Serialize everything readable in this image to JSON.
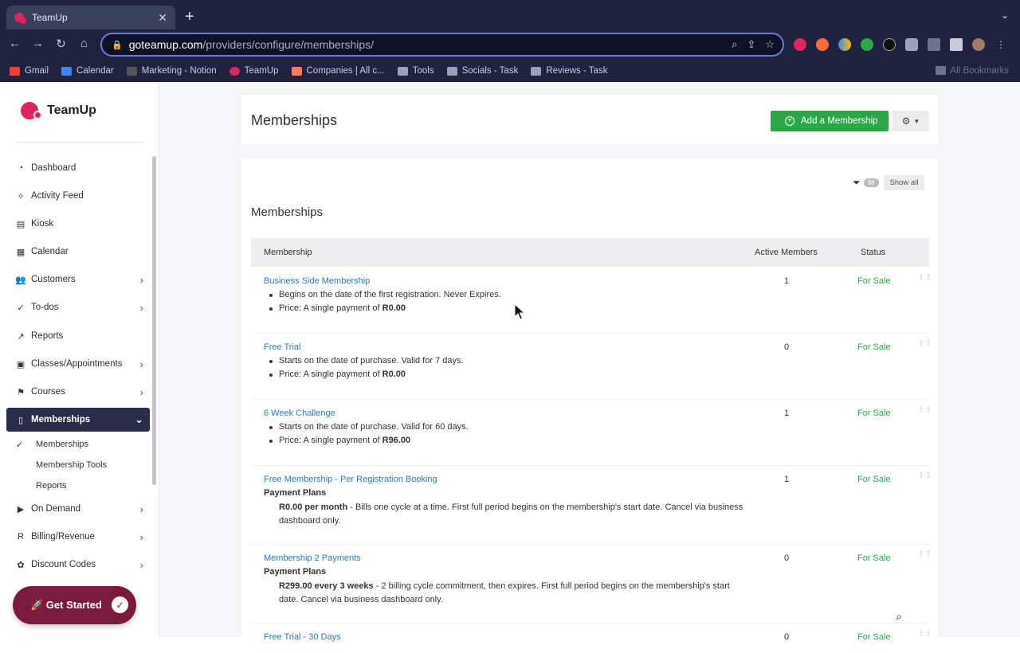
{
  "browser": {
    "tab_title": "TeamUp",
    "tab_close": "✕",
    "new_tab": "+",
    "url_host": "goteamup.com",
    "url_path": "/providers/configure/memberships/",
    "bookmarks": [
      {
        "label": "Gmail",
        "color": "#ea4335"
      },
      {
        "label": "Calendar",
        "color": "#4285f4"
      },
      {
        "label": "Marketing - Notion",
        "color": "#555555"
      },
      {
        "label": "TeamUp",
        "color": "#e0245e"
      },
      {
        "label": "Companies | All c...",
        "color": "#ff7a59"
      },
      {
        "label": "Tools",
        "color": "#9aa0b8"
      },
      {
        "label": "Socials - Task",
        "color": "#9aa0b8"
      },
      {
        "label": "Reviews - Task",
        "color": "#9aa0b8"
      }
    ],
    "all_bookmarks": "All Bookmarks"
  },
  "sidebar": {
    "brand": "TeamUp",
    "items": [
      {
        "label": "Dashboard",
        "icon": "dashboard-icon",
        "glyph": "◔",
        "has_chevron": false
      },
      {
        "label": "Activity Feed",
        "icon": "activity-icon",
        "glyph": "✧",
        "has_chevron": false
      },
      {
        "label": "Kiosk",
        "icon": "kiosk-icon",
        "glyph": "▤",
        "has_chevron": false
      },
      {
        "label": "Calendar",
        "icon": "calendar-icon",
        "glyph": "▦",
        "has_chevron": false
      },
      {
        "label": "Customers",
        "icon": "customers-icon",
        "glyph": "👥",
        "has_chevron": true
      },
      {
        "label": "To-dos",
        "icon": "todos-icon",
        "glyph": "✓",
        "has_chevron": true
      },
      {
        "label": "Reports",
        "icon": "reports-icon",
        "glyph": "↗",
        "has_chevron": false
      },
      {
        "label": "Classes/Appointments",
        "icon": "classes-icon",
        "glyph": "▣",
        "has_chevron": true
      },
      {
        "label": "Courses",
        "icon": "courses-icon",
        "glyph": "⚑",
        "has_chevron": true
      },
      {
        "label": "Memberships",
        "icon": "memberships-icon",
        "glyph": "▯",
        "has_chevron": true,
        "active": true
      },
      {
        "label": "On Demand",
        "icon": "on-demand-icon",
        "glyph": "▶",
        "has_chevron": true
      },
      {
        "label": "Billing/Revenue",
        "icon": "billing-icon",
        "glyph": "R",
        "has_chevron": true
      },
      {
        "label": "Discount Codes",
        "icon": "discount-icon",
        "glyph": "✿",
        "has_chevron": true
      }
    ],
    "sub_items": [
      "Memberships",
      "Membership Tools",
      "Reports"
    ],
    "get_started": "🚀 Get Started"
  },
  "header": {
    "title": "Memberships",
    "add_button": "Add a Membership"
  },
  "list": {
    "filter_count": "98",
    "show_all": "Show all",
    "section_title": "Memberships",
    "columns": {
      "membership": "Membership",
      "active": "Active Members",
      "status": "Status"
    },
    "rows": [
      {
        "name": "Business Side Membership",
        "line1": "Begins on the date of the first registration. Never Expires.",
        "price_prefix": "Price: A single payment of ",
        "price": "R0.00",
        "active": "1",
        "status": "For Sale"
      },
      {
        "name": "Free Trial",
        "line1": "Starts on the date of purchase. Valid for 7 days.",
        "price_prefix": "Price: A single payment of ",
        "price": "R0.00",
        "active": "0",
        "status": "For Sale"
      },
      {
        "name": "6 Week Challenge",
        "line1": "Starts on the date of purchase. Valid for 60 days.",
        "price_prefix": "Price: A single payment of ",
        "price": "R96.00",
        "active": "1",
        "status": "For Sale"
      },
      {
        "name": "Free Membership - Per Registration Booking",
        "plans_label": "Payment Plans",
        "plan_bold": "R0.00 per month",
        "plan_rest": " - Bills one cycle at a time. First full period begins on the membership's start date. Cancel via business dashboard only.",
        "active": "1",
        "status": "For Sale"
      },
      {
        "name": "Membership 2 Payments",
        "plans_label": "Payment Plans",
        "plan_bold": "R299.00 every 3 weeks",
        "plan_rest": " - 2 billing cycle commitment, then expires. First full period begins on the membership's start date. Cancel via business dashboard only.",
        "active": "0",
        "status": "For Sale"
      },
      {
        "name": "Free Trial - 30 Days",
        "active": "0",
        "status": "For Sale"
      }
    ]
  }
}
